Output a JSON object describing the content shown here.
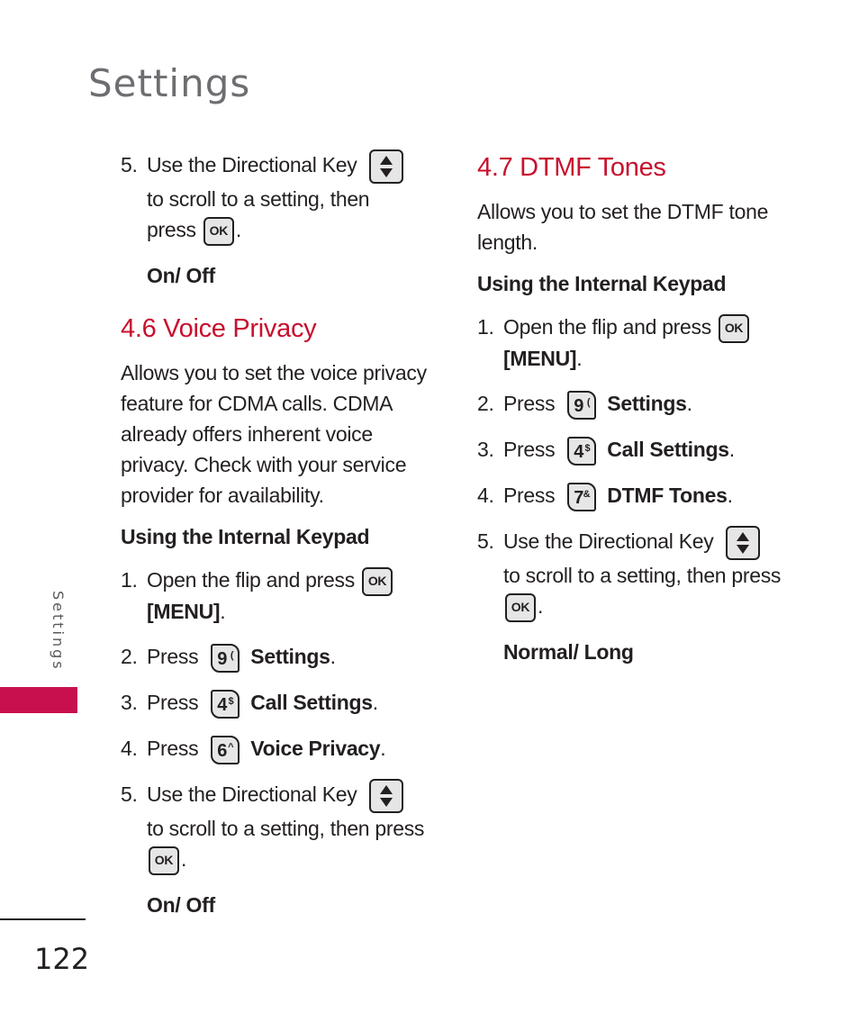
{
  "page": {
    "title": "Settings",
    "side_label": "Settings",
    "page_number": "122",
    "accent_color": "#c8102e"
  },
  "left": {
    "cont_step": {
      "num": "5.",
      "line1": "Use the Directional Key",
      "line2": "to scroll to a setting, then",
      "line3": "press",
      "tail": ".",
      "result": "On/ Off"
    },
    "section": {
      "heading": "4.6 Voice Privacy",
      "description": "Allows you to set the voice privacy feature for CDMA calls. CDMA already offers inherent voice privacy. Check with your service provider for availability.",
      "subheading": "Using the Internal Keypad",
      "steps": [
        {
          "num": "1.",
          "text": "Open the flip and press",
          "key": "OK",
          "bold": "[MENU]",
          "tail": "."
        },
        {
          "num": "2.",
          "text": "Press",
          "key_digit": "9",
          "key_sym": "(",
          "bold": "Settings",
          "tail": "."
        },
        {
          "num": "3.",
          "text": "Press",
          "key_digit": "4",
          "key_sym": "$",
          "bold": "Call Settings",
          "tail": "."
        },
        {
          "num": "4.",
          "text": "Press",
          "key_digit": "6",
          "key_sym": "^",
          "bold": "Voice Privacy",
          "tail": "."
        },
        {
          "num": "5.",
          "text": "Use the Directional Key",
          "line2": "to scroll to a setting, then press",
          "key": "OK",
          "tail": "."
        }
      ],
      "result": "On/ Off"
    }
  },
  "right": {
    "section": {
      "heading": "4.7 DTMF Tones",
      "description": "Allows you to set the DTMF tone length.",
      "subheading": "Using the Internal Keypad",
      "steps": [
        {
          "num": "1.",
          "text": "Open the flip and press",
          "key": "OK",
          "bold": "[MENU]",
          "tail": "."
        },
        {
          "num": "2.",
          "text": "Press",
          "key_digit": "9",
          "key_sym": "(",
          "bold": "Settings",
          "tail": "."
        },
        {
          "num": "3.",
          "text": "Press",
          "key_digit": "4",
          "key_sym": "$",
          "bold": "Call Settings",
          "tail": "."
        },
        {
          "num": "4.",
          "text": "Press",
          "key_digit": "7",
          "key_sym": "&",
          "bold": "DTMF Tones",
          "tail": "."
        },
        {
          "num": "5.",
          "text": "Use the Directional Key",
          "line2": "to scroll to a setting, then press",
          "key": "OK",
          "tail": "."
        }
      ],
      "result": "Normal/ Long"
    }
  }
}
